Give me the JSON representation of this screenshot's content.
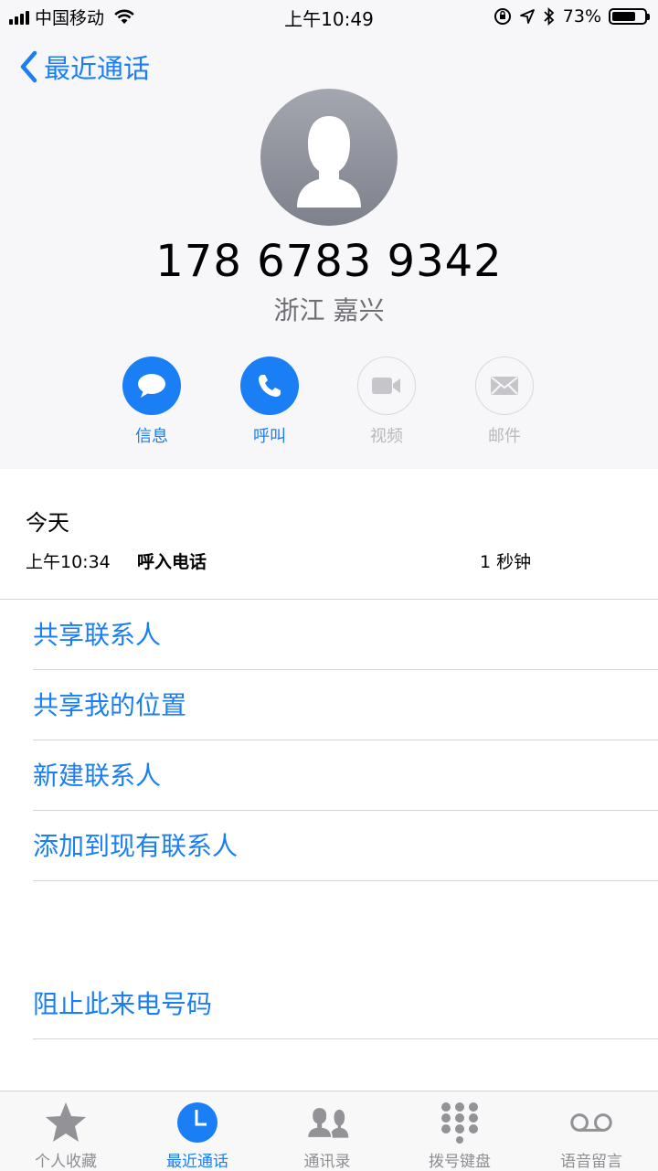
{
  "status_bar": {
    "carrier": "中国移动",
    "time": "上午10:49",
    "battery": "73%",
    "battery_level": 0.73
  },
  "nav": {
    "back_label": "最近通话"
  },
  "contact": {
    "number": "178 6783 9342",
    "location": "浙江 嘉兴"
  },
  "actions": [
    {
      "label": "信息",
      "icon": "message-icon",
      "enabled": true
    },
    {
      "label": "呼叫",
      "icon": "phone-icon",
      "enabled": true
    },
    {
      "label": "视频",
      "icon": "video-icon",
      "enabled": false
    },
    {
      "label": "邮件",
      "icon": "mail-icon",
      "enabled": false
    }
  ],
  "history": {
    "day": "今天",
    "entries": [
      {
        "time": "上午10:34",
        "type": "呼入电话",
        "duration": "1 秒钟"
      }
    ]
  },
  "menu": {
    "share_contact": "共享联系人",
    "share_location": "共享我的位置",
    "new_contact": "新建联系人",
    "add_existing": "添加到现有联系人",
    "block": "阻止此来电号码"
  },
  "tabbar": [
    {
      "label": "个人收藏",
      "icon": "star-icon",
      "selected": false
    },
    {
      "label": "最近通话",
      "icon": "clock-icon",
      "selected": true
    },
    {
      "label": "通讯录",
      "icon": "contacts-icon",
      "selected": false
    },
    {
      "label": "拨号键盘",
      "icon": "keypad-icon",
      "selected": false
    },
    {
      "label": "语音留言",
      "icon": "voicemail-icon",
      "selected": false
    }
  ],
  "colors": {
    "accent": "#1a7ef5",
    "header_bg": "#f7f7fa",
    "disabled": "#b8b8bd",
    "tab_inactive": "#8e8e93"
  }
}
